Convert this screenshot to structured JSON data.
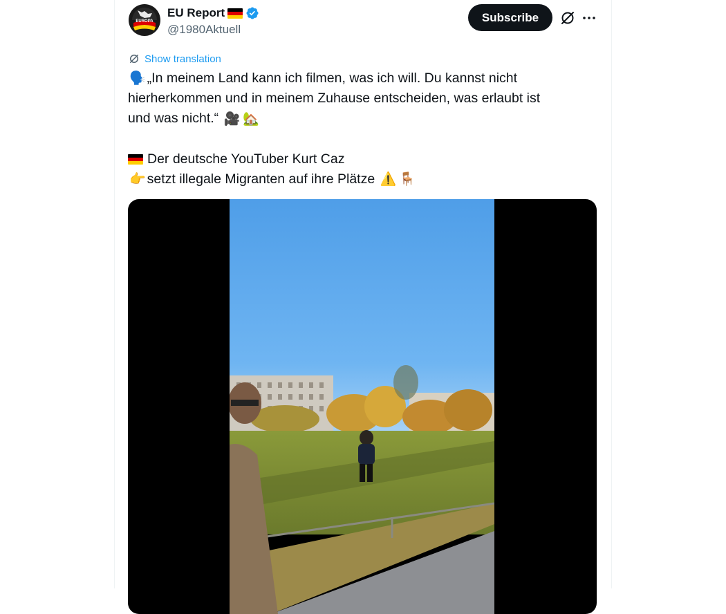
{
  "author": {
    "name": "EU Report",
    "handle": "@1980Aktuell",
    "avatar_text": "EUROPA"
  },
  "actions": {
    "subscribe_label": "Subscribe",
    "grok_icon": "grok-icon",
    "more_icon": "more-icon"
  },
  "translation": {
    "label": "Show translation"
  },
  "tweet": {
    "line1": "„In meinem Land kann ich filmen, was ich will. Du kannst nicht",
    "line2": "hierherkommen und in meinem Zuhause entscheiden, was erlaubt ist",
    "line3": "und was nicht.“",
    "line4": "Der deutsche YouTuber Kurt Caz",
    "line5": "setzt illegale Migranten auf ihre Plätze",
    "emoji_speaking": "🗣️",
    "emoji_camera": "🎥",
    "emoji_house": "🏡",
    "emoji_flag": "🇩🇪",
    "emoji_point": "👉",
    "emoji_warning": "⚠️",
    "emoji_chair": "🪑"
  },
  "colors": {
    "accent": "#1d9bf0",
    "text": "#0f1419",
    "secondary": "#536471"
  }
}
